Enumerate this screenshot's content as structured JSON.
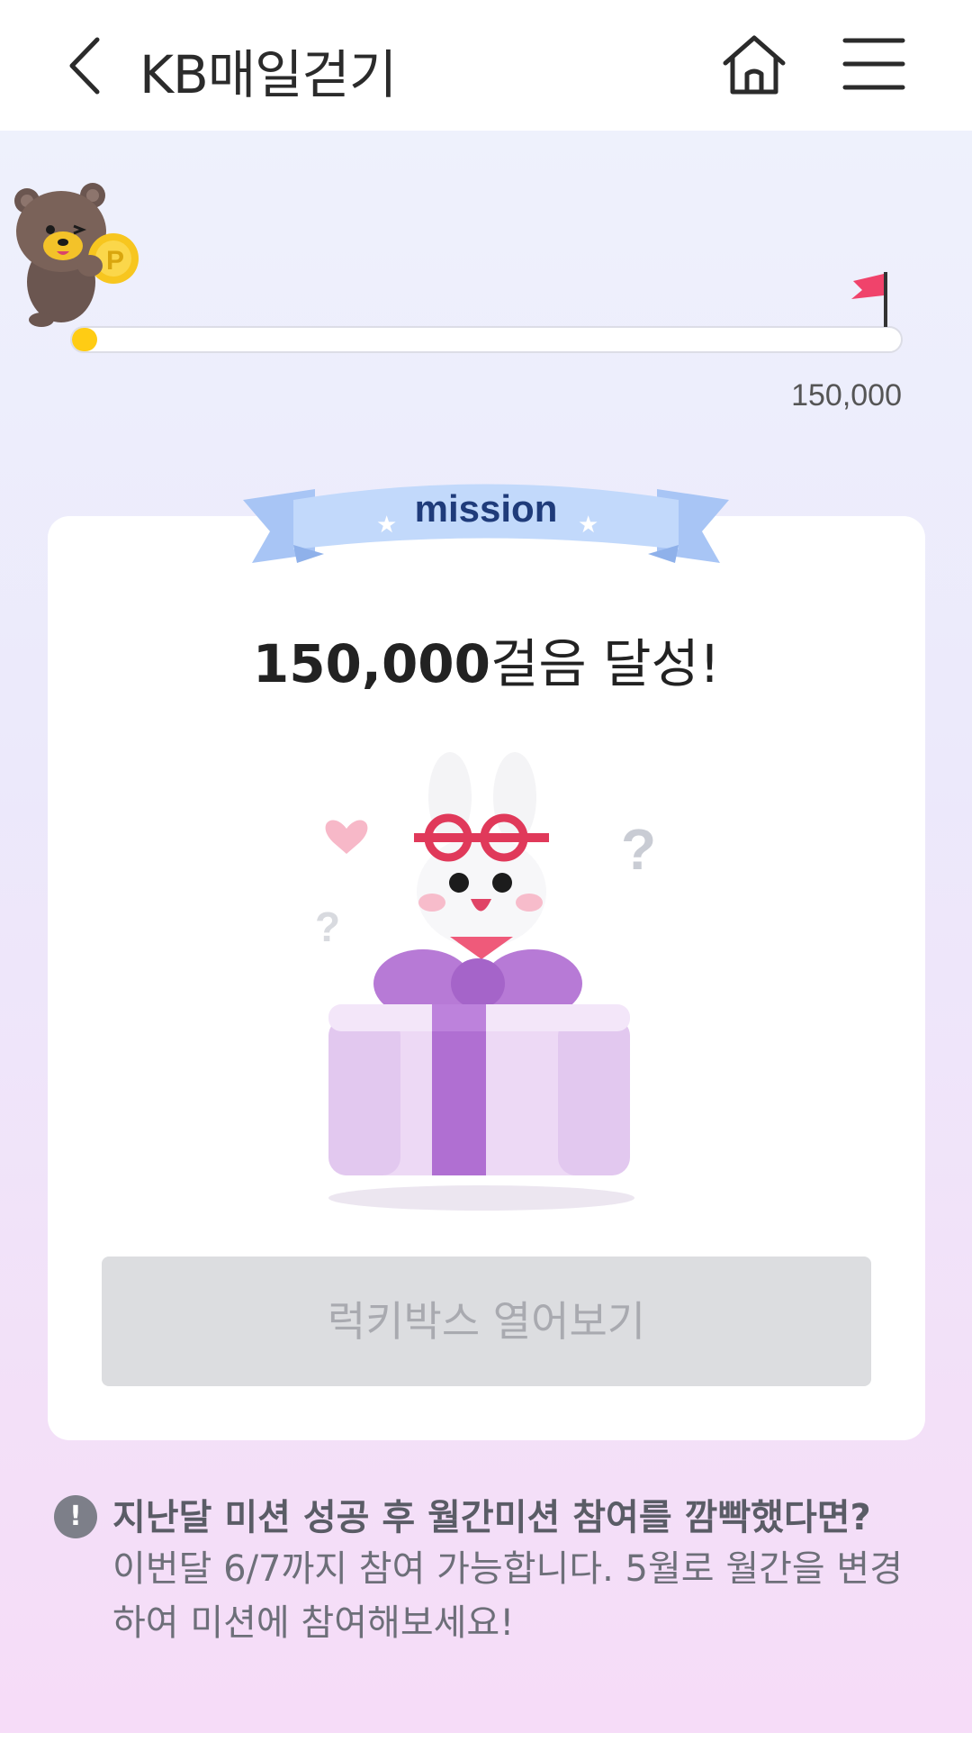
{
  "header": {
    "title": "KB매일걷기",
    "back_icon": "chevron-left-icon",
    "home_icon": "home-icon",
    "menu_icon": "hamburger-menu-icon"
  },
  "progress": {
    "goal_label": "150,000",
    "progress_fraction": 0.03,
    "fill_color": "#ffcc14"
  },
  "mission": {
    "ribbon_label": "mission",
    "achievement_number": "150,000",
    "achievement_suffix": "걸음 달성!",
    "button_label": "럭키박스 열어보기"
  },
  "notice": {
    "icon_text": "!",
    "title": "지난달 미션 성공 후 월간미션 참여를 깜빡했다면?",
    "body": "이번달 6/7까지 참여 가능합니다. 5월로 월간을 변경하여 미션에 참여해보세요!"
  }
}
